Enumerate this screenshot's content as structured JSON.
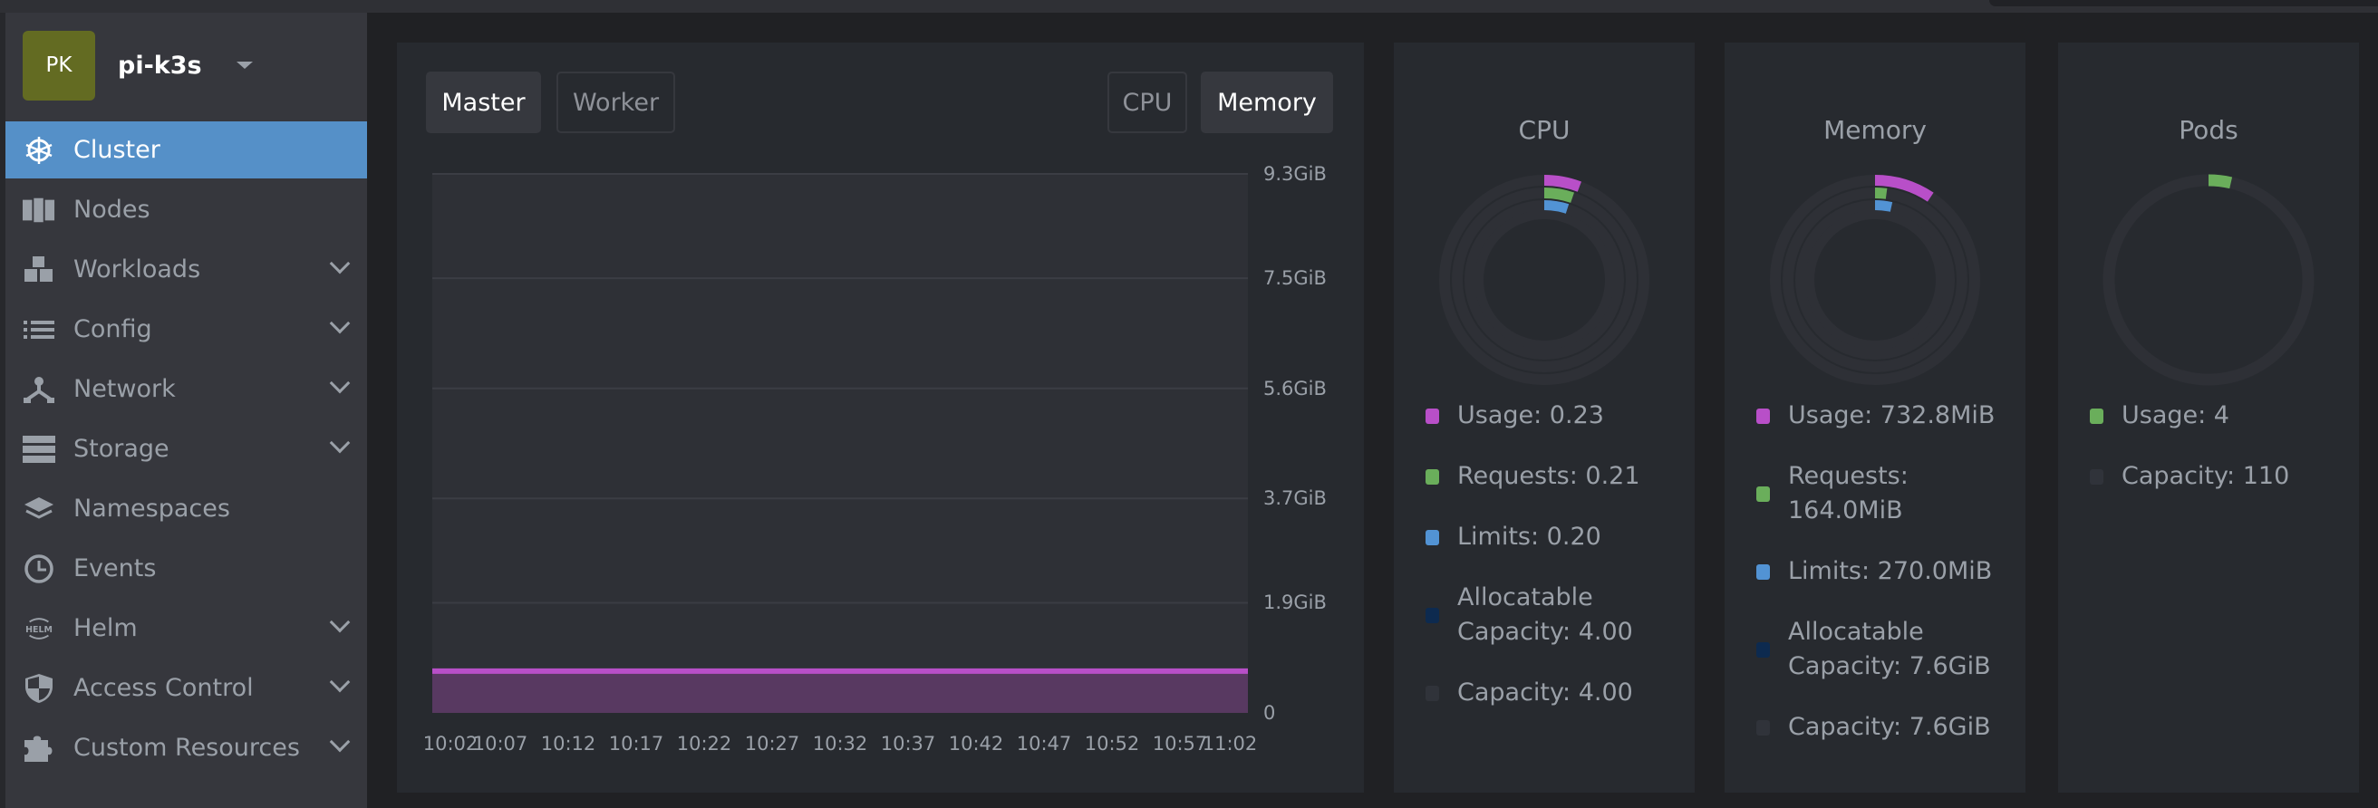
{
  "cluster": {
    "avatar_initials": "PK",
    "name": "pi-k3s",
    "avatar_color": "#636b22"
  },
  "sidebar": {
    "items": [
      {
        "label": "Cluster",
        "icon": "kubernetes-helm-wheel-icon",
        "active": true,
        "expandable": false
      },
      {
        "label": "Nodes",
        "icon": "server-rack-icon",
        "expandable": false
      },
      {
        "label": "Workloads",
        "icon": "cubes-icon",
        "expandable": true
      },
      {
        "label": "Config",
        "icon": "list-icon",
        "expandable": true
      },
      {
        "label": "Network",
        "icon": "network-topology-icon",
        "expandable": true
      },
      {
        "label": "Storage",
        "icon": "storage-icon",
        "expandable": true
      },
      {
        "label": "Namespaces",
        "icon": "layers-icon",
        "expandable": false
      },
      {
        "label": "Events",
        "icon": "clock-icon",
        "expandable": false
      },
      {
        "label": "Helm",
        "icon": "helm-icon",
        "expandable": true
      },
      {
        "label": "Access Control",
        "icon": "shield-icon",
        "expandable": true
      },
      {
        "label": "Custom Resources",
        "icon": "puzzle-icon",
        "expandable": true
      }
    ]
  },
  "metrics_panel": {
    "node_tabs": [
      {
        "label": "Master",
        "selected": true
      },
      {
        "label": "Worker",
        "selected": false
      }
    ],
    "metric_tabs": [
      {
        "label": "CPU",
        "selected": false
      },
      {
        "label": "Memory",
        "selected": true
      }
    ]
  },
  "chart_data": {
    "type": "area",
    "y_ticks": [
      "9.3GiB",
      "7.5GiB",
      "5.6GiB",
      "3.7GiB",
      "1.9GiB",
      "0"
    ],
    "y_tick_values": [
      9.3,
      7.5,
      5.6,
      3.7,
      1.9,
      0
    ],
    "ylim": [
      0,
      9.3
    ],
    "y_unit": "GiB",
    "x_ticks": [
      "10:02",
      "10:07",
      "10:12",
      "10:17",
      "10:22",
      "10:27",
      "10:32",
      "10:37",
      "10:42",
      "10:47",
      "10:52",
      "10:57",
      "11:02"
    ],
    "series": [
      {
        "values": [
          0.72,
          0.72,
          0.72,
          0.72,
          0.72,
          0.72,
          0.72,
          0.72,
          0.72,
          0.72,
          0.72,
          0.72,
          0.72
        ],
        "color": "#b84fc8"
      }
    ],
    "grid": true
  },
  "colors": {
    "usage": "#b84fc8",
    "requests": "#6aae5b",
    "limits": "#5293d4",
    "allocatable": "#0d2a4f",
    "capacity": "#30333a"
  },
  "cards": [
    {
      "title": "CPU",
      "rings": [
        {
          "key": "usage",
          "fraction": 0.0575
        },
        {
          "key": "requests",
          "fraction": 0.0525
        },
        {
          "key": "limits",
          "fraction": 0.05
        }
      ],
      "legend": [
        {
          "key": "usage",
          "label": "Usage: 0.23"
        },
        {
          "key": "requests",
          "label": "Requests: 0.21"
        },
        {
          "key": "limits",
          "label": "Limits: 0.20"
        },
        {
          "key": "allocatable",
          "label": "Allocatable Capacity: 4.00"
        },
        {
          "key": "capacity",
          "label": "Capacity: 4.00"
        }
      ]
    },
    {
      "title": "Memory",
      "rings": [
        {
          "key": "usage",
          "fraction": 0.094
        },
        {
          "key": "requests",
          "fraction": 0.021
        },
        {
          "key": "limits",
          "fraction": 0.035
        }
      ],
      "legend": [
        {
          "key": "usage",
          "label": "Usage: 732.8MiB"
        },
        {
          "key": "requests",
          "label": "Requests: 164.0MiB"
        },
        {
          "key": "limits",
          "label": "Limits: 270.0MiB"
        },
        {
          "key": "allocatable",
          "label": "Allocatable Capacity: 7.6GiB"
        },
        {
          "key": "capacity",
          "label": "Capacity: 7.6GiB"
        }
      ]
    },
    {
      "title": "Pods",
      "rings": [
        {
          "key": "requests",
          "fraction": 0.036
        }
      ],
      "legend": [
        {
          "key": "requests",
          "label": "Usage: 4"
        },
        {
          "key": "capacity",
          "label": "Capacity: 110"
        }
      ]
    }
  ]
}
